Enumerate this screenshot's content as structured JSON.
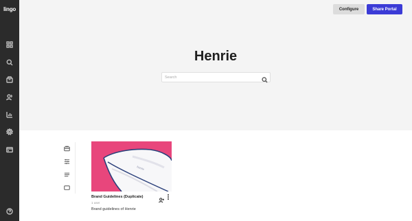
{
  "app": {
    "logo_text": "lingo"
  },
  "sidebar": {
    "items": [
      {
        "icon": "grid-icon"
      },
      {
        "icon": "search-icon"
      },
      {
        "icon": "package-icon"
      },
      {
        "icon": "users-icon"
      },
      {
        "icon": "chart-icon"
      },
      {
        "icon": "gear-icon"
      },
      {
        "icon": "card-icon"
      },
      {
        "icon": "help-icon"
      }
    ]
  },
  "header": {
    "configure_label": "Configure",
    "share_label": "Share Portal"
  },
  "portal": {
    "title": "Henrie",
    "search_placeholder": "Search"
  },
  "filters": [
    {
      "icon": "kit-icon"
    },
    {
      "icon": "sliders-icon"
    },
    {
      "icon": "list-icon"
    },
    {
      "icon": "card-view-icon"
    }
  ],
  "cards": [
    {
      "title": "Brand Guidelines (Duplicate)",
      "meta": "1 user",
      "description": "Brand guidelines of Henrie",
      "thumb_color": "#e8467c"
    }
  ],
  "colors": {
    "accent": "#3b3bd6",
    "sidebar_bg": "#2b2b2b",
    "hero_bg": "#f4f4f4"
  }
}
